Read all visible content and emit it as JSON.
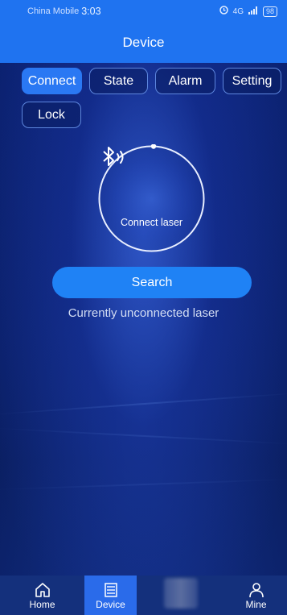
{
  "status_bar": {
    "carrier": "China Mobile",
    "time": "3:03",
    "signal": "4G",
    "battery": "98"
  },
  "header": {
    "title": "Device"
  },
  "tabs": [
    {
      "label": "Connect",
      "active": true
    },
    {
      "label": "State",
      "active": false
    },
    {
      "label": "Alarm",
      "active": false
    },
    {
      "label": "Setting",
      "active": false
    },
    {
      "label": "Lock",
      "active": false
    }
  ],
  "connect": {
    "circle_label": "Connect laser",
    "search_label": "Search",
    "status_text": "Currently unconnected laser"
  },
  "bottom_nav": [
    {
      "label": "Home",
      "icon": "home-icon",
      "active": false
    },
    {
      "label": "Device",
      "icon": "device-icon",
      "active": true
    },
    {
      "label": "",
      "icon": "blurred-icon",
      "active": false
    },
    {
      "label": "Mine",
      "icon": "user-icon",
      "active": false
    }
  ],
  "colors": {
    "accent": "#1f73f0",
    "active_tab": "#2a78f3",
    "background": "#0a1f6a"
  }
}
